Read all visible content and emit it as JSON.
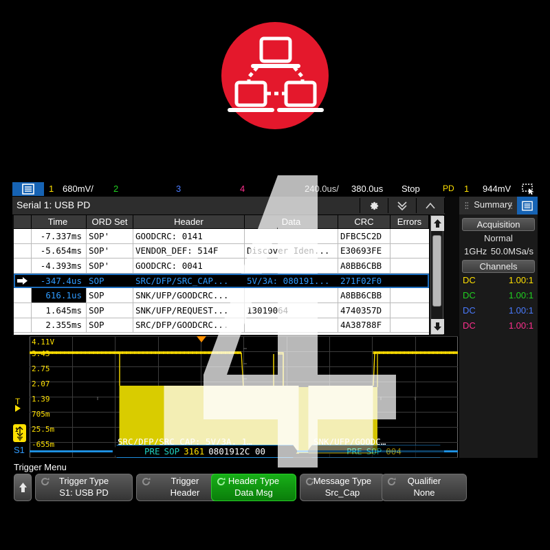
{
  "logo": {
    "color": "#e4182c",
    "icon": "network-topology-icon"
  },
  "statusbar": {
    "menu_icon": "menu-icon",
    "ch1_num": "1",
    "ch1_scale": "680mV/",
    "ch2_num": "2",
    "ch3_num": "3",
    "ch4_num": "4",
    "timebase": "240.0us/",
    "delay": "380.0us",
    "run_state": "Stop",
    "trig_source": "PD",
    "trig_chan": "1",
    "trig_level": "944mV",
    "cursor_icon": "selection-cursor-icon"
  },
  "serial": {
    "title": "Serial 1: USB PD",
    "tools": [
      {
        "name": "settings-gear-icon",
        "glyph": "gear"
      },
      {
        "name": "scroll-down-icon",
        "glyph": "chevron-double-down"
      },
      {
        "name": "scroll-up-icon",
        "glyph": "chevron-up"
      }
    ],
    "columns": [
      "Time",
      "ORD Set",
      "Header",
      "Data",
      "CRC",
      "Errors"
    ],
    "rows": [
      {
        "time": "-7.337ms",
        "ord": "SOP'",
        "header": "GOODCRC: 0141",
        "data": "",
        "crc": "DFBC5C2D",
        "err": "",
        "selected": false,
        "highlight": false
      },
      {
        "time": "-5.654ms",
        "ord": "SOP'",
        "header": "VENDOR_DEF: 514F",
        "data": "Discover Iden...",
        "crc": "E30693FE",
        "err": "",
        "selected": false,
        "highlight": false
      },
      {
        "time": "-4.393ms",
        "ord": "SOP'",
        "header": "GOODCRC: 0041",
        "data": "",
        "crc": "A8BB6CBB",
        "err": "",
        "selected": false,
        "highlight": false
      },
      {
        "time": "-347.4us",
        "ord": "SOP",
        "header": "SRC/DFP/SRC_CAP...",
        "data": "5V/3A: 080191...",
        "crc": "271F02F0",
        "err": "",
        "selected": true,
        "highlight": false
      },
      {
        "time": "616.1us",
        "ord": "SOP",
        "header": "SNK/UFP/GOODCRC...",
        "data": "",
        "crc": "A8BB6CBB",
        "err": "",
        "selected": false,
        "highlight": true
      },
      {
        "time": "1.645ms",
        "ord": "SOP",
        "header": "SNK/UFP/REQUEST...",
        "data": "13019064",
        "crc": "4740357D",
        "err": "",
        "selected": false,
        "highlight": false
      },
      {
        "time": "2.355ms",
        "ord": "SOP",
        "header": "SRC/DFP/GOODCRC...",
        "data": "",
        "crc": "4A38788F",
        "err": "",
        "selected": false,
        "highlight": false
      }
    ],
    "scrollbar": {
      "up_icon": "scroll-up-arrow-icon",
      "down_icon": "scroll-down-arrow-icon"
    }
  },
  "summary": {
    "tab_label": "Summary",
    "tab_icon": "list-panel-icon",
    "acquisition_label": "Acquisition",
    "acq_mode": "Normal",
    "acq_bandwidth": "1GHz",
    "acq_rate": "50.0MSa/s",
    "channels_label": "Channels",
    "channels": [
      {
        "coupling": "DC",
        "probe": "1.00:1",
        "color": "#ffe000"
      },
      {
        "coupling": "DC",
        "probe": "1.00:1",
        "color": "#20d020"
      },
      {
        "coupling": "DC",
        "probe": "1.00:1",
        "color": "#4a7bff"
      },
      {
        "coupling": "DC",
        "probe": "1.00:1",
        "color": "#ff2f8e"
      }
    ]
  },
  "waveform": {
    "v_labels": [
      "4.11V",
      "3.43",
      "2.75",
      "2.07",
      "1.39",
      "705m",
      "25.5m",
      "-655m"
    ],
    "trigger_label": "T",
    "channel_badge": "1",
    "bus_badge": "S1",
    "decode_rows": [
      {
        "text": "SRC/DFP/SRC_CAP: 5V/3A, 1…"
      },
      {
        "text": "SNK/UFP/GOODC…"
      }
    ],
    "packets": [
      {
        "pre": "PRE",
        "sop": "SOP",
        "hdr": "3161",
        "data": "0801912C 00",
        "dim": false
      },
      {
        "pre": "PRE",
        "sop": "SOP",
        "hdr": "004",
        "data": "",
        "dim": true
      }
    ]
  },
  "trigger_menu": {
    "title": "Trigger Menu",
    "up_icon": "up-arrow-icon",
    "keys": [
      {
        "line1": "Trigger Type",
        "line2": "S1: USB PD",
        "active": false,
        "knob": "rotary-knob-icon"
      },
      {
        "line1": "Trigger",
        "line2": "Header",
        "active": false,
        "knob": "rotary-knob-icon"
      },
      {
        "line1": "Header Type",
        "line2": "Data Msg",
        "active": true,
        "knob": "rotary-knob-icon"
      },
      {
        "line1": "Message Type",
        "line2": "Src_Cap",
        "active": false,
        "knob": "rotary-knob-icon"
      },
      {
        "line1": "Qualifier",
        "line2": "None",
        "active": false,
        "knob": "rotary-knob-icon"
      }
    ]
  }
}
